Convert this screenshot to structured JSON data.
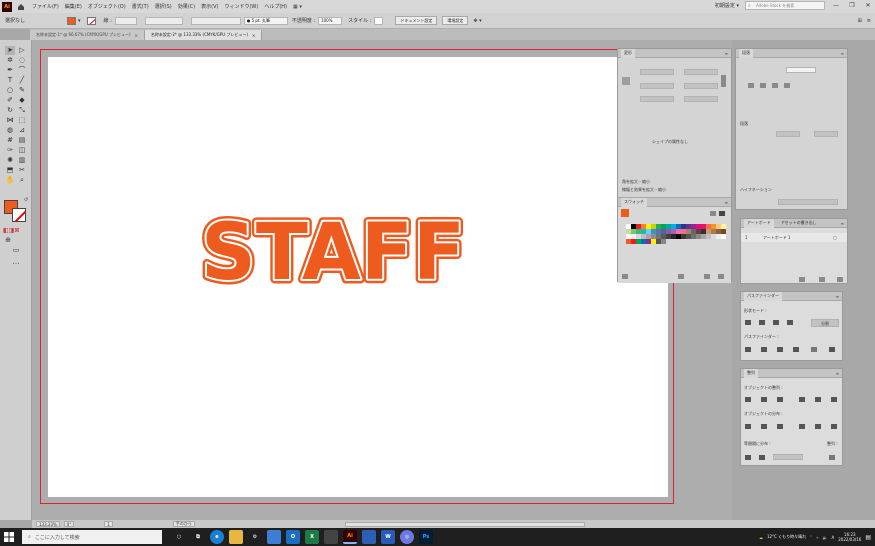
{
  "menubar": {
    "logo": "Ai",
    "items": [
      "ファイル(F)",
      "編集(E)",
      "オブジェクト(O)",
      "書式(T)",
      "選択(S)",
      "効果(C)",
      "表示(V)",
      "ウィンドウ(W)",
      "ヘルプ(H)"
    ],
    "workspace": "初期設定",
    "stock_placeholder": "Adobe Stock を検索"
  },
  "control": {
    "selection": "選択なし",
    "stroke_label": "線 :",
    "brush_label": "● 5 pt. 丸筆",
    "opacity_label": "不透明度 :",
    "opacity_value": "100%",
    "style_label": "スタイル :",
    "doc_setup": "ドキュメント設定",
    "prefs": "環境設定",
    "colors": {
      "fill": "#ee5b1f",
      "stroke_none": "#ffffff"
    }
  },
  "tabs": [
    {
      "label": "名称未設定-1* @ 66.67% (CMYK/GPU プレビュー)",
      "active": false
    },
    {
      "label": "名称未設定-2* @ 133.33% (CMYK/GPU プレビュー)",
      "active": true
    }
  ],
  "artboard": {
    "text": "STAFF",
    "fill": "#ee5b1f",
    "outline": "#ee5b1f"
  },
  "panels": {
    "transform": {
      "tab": "変形",
      "empty": "シェイプの属性なし",
      "opt1": "角を拡大・縮小",
      "opt2": "線幅と効果を拡大・縮小"
    },
    "swatches": {
      "tab": "スウォッチ"
    },
    "character": {
      "tab": "段落",
      "indent": "段落",
      "hyphen": "ハイフネーション",
      "body": "ハイフネーション"
    },
    "artboards": {
      "tab": "アートボード",
      "tab2": "アセットの書き出し",
      "row_num": "1",
      "row_name": "アートボード 1",
      "row_end": "▢"
    },
    "pathfinder": {
      "tab": "パスファインダー",
      "shape_modes": "形状モード :",
      "expand": "分割",
      "pathfinders": "パスファインダー :"
    },
    "align": {
      "tab": "整列",
      "align_objects": "オブジェクトの整列 :",
      "distribute_objects": "オブジェクトの分布 :",
      "distribute_spacing": "等間隔に分布 :",
      "align_to": "整列 :"
    }
  },
  "status": {
    "zoom": "133.33%",
    "rotation": "0°",
    "page": "1",
    "tool": "手のひら"
  },
  "taskbar": {
    "search_placeholder": "ここに入力して検索",
    "weather": "12°C くもり時々晴れ",
    "ime": "A",
    "time": "16:23",
    "date": "2022/03/16"
  }
}
